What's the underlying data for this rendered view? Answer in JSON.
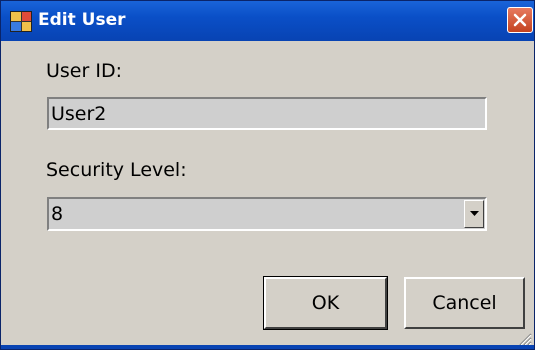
{
  "window": {
    "title": "Edit User",
    "title_icon": "app-window-icon",
    "close_icon": "close-icon"
  },
  "form": {
    "user_id_label": "User ID:",
    "user_id_value": "User2",
    "security_level_label": "Security Level:",
    "security_level_value": "8",
    "dropdown_icon": "chevron-down-icon"
  },
  "buttons": {
    "ok_label": "OK",
    "cancel_label": "Cancel"
  },
  "colors": {
    "titlebar": "#0a4fc7",
    "dialog_bg": "#d4d0c8",
    "close_button": "#d9502f"
  }
}
